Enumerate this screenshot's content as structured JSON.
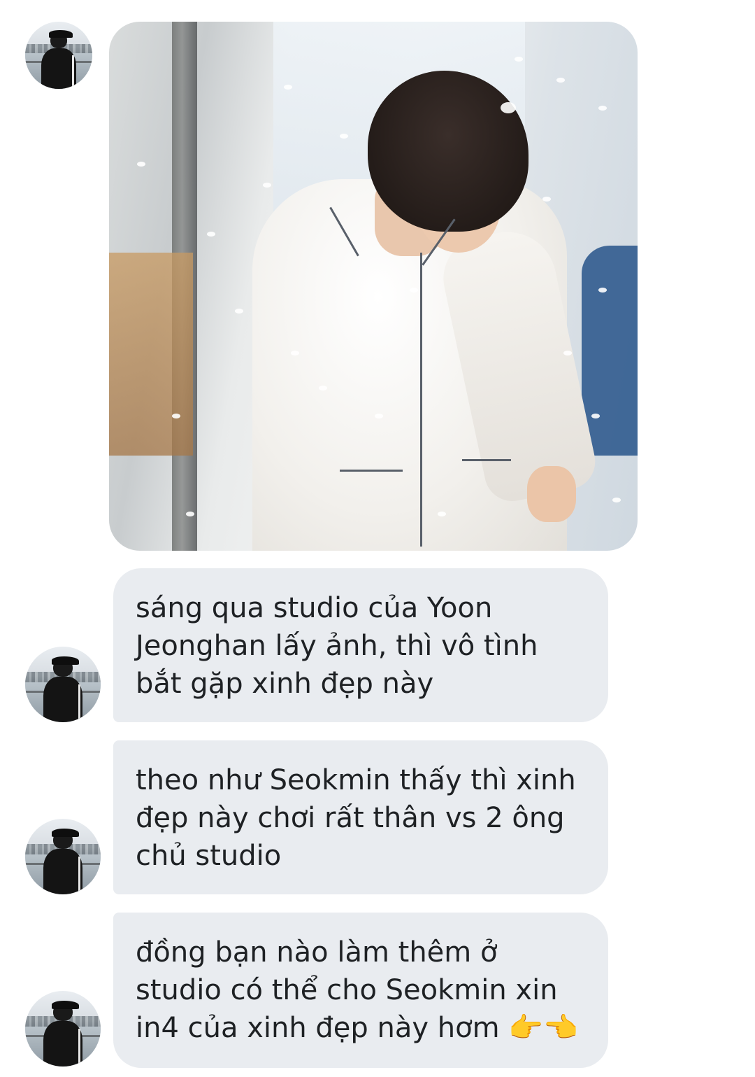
{
  "conversation": {
    "sender": {
      "avatar_icon": "profile-photo-man-black-cap"
    },
    "photo_message": {
      "description_icon": "image-attachment"
    },
    "messages": [
      {
        "text": "sáng qua studio của Yoon Jeonghan lấy ảnh, thì vô tình bắt gặp xinh đẹp này"
      },
      {
        "text": "theo như Seokmin thấy thì xinh đẹp này chơi rất thân vs 2 ông chủ studio"
      },
      {
        "text": "đồng bạn nào làm thêm ở studio có thể cho Seokmin xin in4 của xinh đẹp này hơm",
        "emoji": "👉👈"
      }
    ],
    "colors": {
      "bubble_bg": "#e9ecf0",
      "text": "#1e2124",
      "background": "#ffffff"
    }
  }
}
